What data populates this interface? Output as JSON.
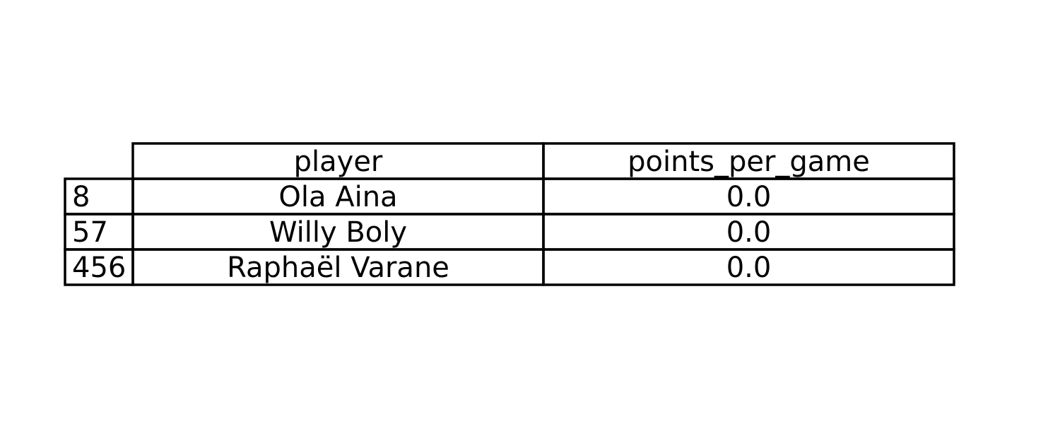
{
  "chart_data": {
    "type": "table",
    "columns": [
      "player",
      "points_per_game"
    ],
    "index": [
      "8",
      "57",
      "456"
    ],
    "rows": [
      [
        "Ola Aina",
        "0.0"
      ],
      [
        "Willy Boly",
        "0.0"
      ],
      [
        "Raphaël Varane",
        "0.0"
      ]
    ]
  }
}
